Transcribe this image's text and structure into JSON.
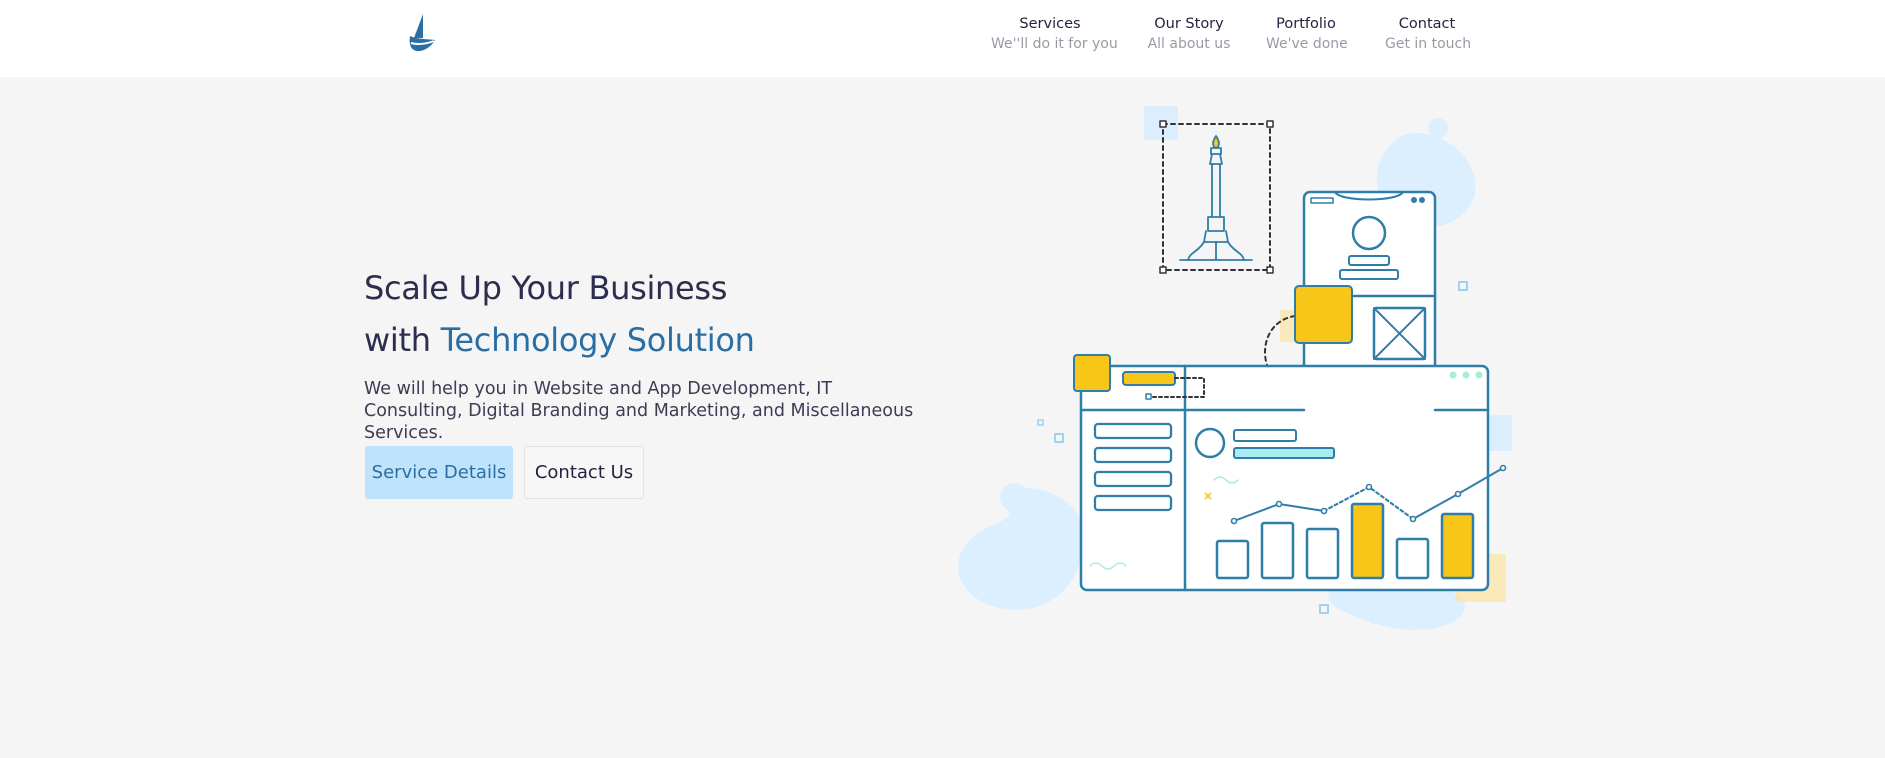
{
  "header": {
    "logo_icon": "sailboat-icon",
    "nav": [
      {
        "title": "Services",
        "subtitle": "We''ll do it for you"
      },
      {
        "title": "Our Story",
        "subtitle": "All about us"
      },
      {
        "title": "Portfolio",
        "subtitle": "We've done"
      },
      {
        "title": "Contact",
        "subtitle": "Get in touch"
      }
    ]
  },
  "hero": {
    "title_line1": "Scale Up Your Business",
    "title_line2_prefix": "with ",
    "title_line2_accent": "Technology Solution",
    "description": "We will help you in Website and App Development, IT Consulting, Digital Branding and Marketing, and Miscellaneous Services.",
    "primary_button": "Service Details",
    "secondary_button": "Contact Us"
  },
  "colors": {
    "background": "#f5f5f5",
    "accent": "#2a6ea3",
    "primary_button_bg": "#bee3fa",
    "illustration_stroke": "#2f7ea8",
    "illustration_yellow": "#f8c519",
    "illustration_blob": "#dcefff"
  },
  "illustration": {
    "icon": "web-app-dashboard-illustration"
  }
}
